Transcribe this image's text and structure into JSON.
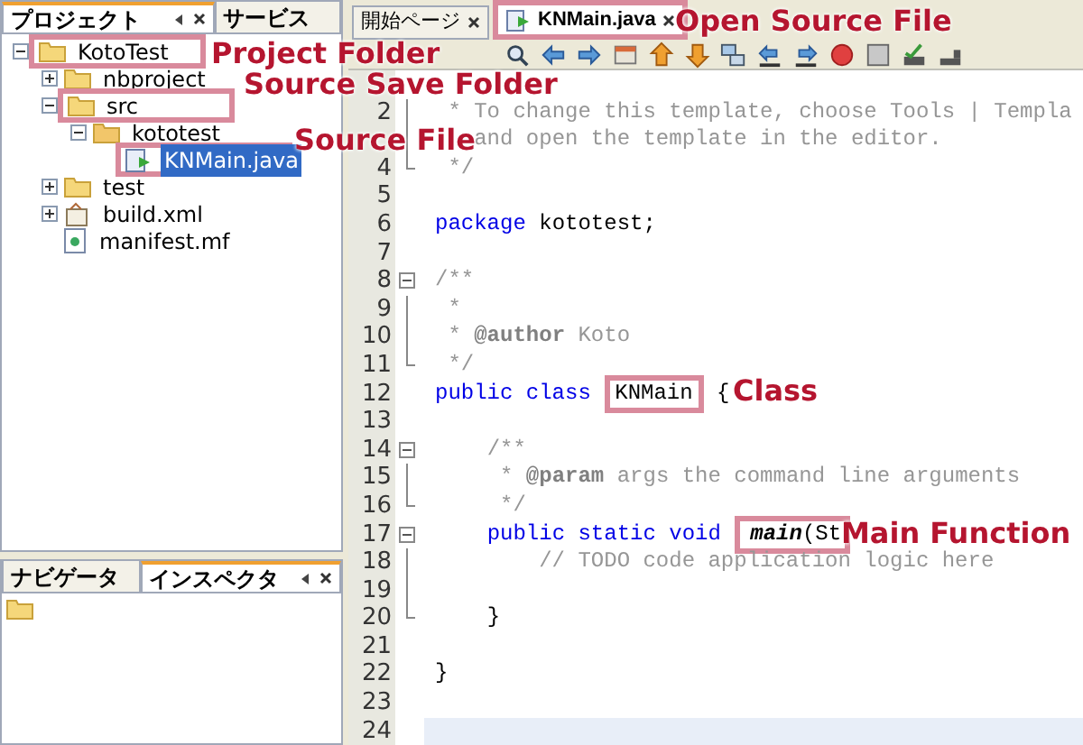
{
  "project_panel": {
    "tabs": [
      {
        "label": "プロジェクト",
        "selected": true
      },
      {
        "label": "サービス",
        "selected": false
      }
    ],
    "tree": [
      {
        "label": "KotoTest",
        "kind": "project",
        "expanded": true,
        "selected": false,
        "highlighted": true,
        "children": [
          {
            "label": "nbproject",
            "kind": "folder",
            "expanded": false,
            "selected": false,
            "highlighted": false
          },
          {
            "label": "src",
            "kind": "folder",
            "expanded": true,
            "selected": false,
            "highlighted": true,
            "children": [
              {
                "label": "kototest",
                "kind": "package",
                "expanded": true,
                "selected": false,
                "highlighted": false,
                "children": [
                  {
                    "label": "KNMain.java",
                    "kind": "java",
                    "selected": true,
                    "highlighted": true
                  }
                ]
              }
            ]
          },
          {
            "label": "test",
            "kind": "folder",
            "expanded": false,
            "selected": false,
            "highlighted": false
          },
          {
            "label": "build.xml",
            "kind": "xml",
            "expanded": false,
            "selected": false,
            "highlighted": false
          },
          {
            "label": "manifest.mf",
            "kind": "manifest",
            "selected": false,
            "highlighted": false
          }
        ]
      }
    ]
  },
  "navigator_panel": {
    "tabs": [
      {
        "label": "ナビゲータ",
        "selected": false
      },
      {
        "label": "インスペクタ",
        "selected": true
      }
    ]
  },
  "editor": {
    "tabs": [
      {
        "label": "開始ページ",
        "selected": false,
        "highlighted": false
      },
      {
        "label": "KNMain.java",
        "selected": true,
        "highlighted": true
      }
    ],
    "lines": [
      {
        "kind": "covered",
        "current": false
      },
      {
        "number": "2",
        "kind": "fold_line",
        "current": false,
        "segments": [
          {
            "text": " * To change this template, choose Tools | Templa",
            "kind": "comment"
          }
        ]
      },
      {
        "kind": "fold_line",
        "current": false,
        "segments": [
          {
            "text": "   and open the template in the editor.",
            "kind": "comment"
          }
        ]
      },
      {
        "number": "4",
        "kind": "fold_end",
        "current": false,
        "segments": [
          {
            "text": " */",
            "kind": "comment"
          }
        ]
      },
      {
        "number": "5",
        "kind": "plain",
        "current": false
      },
      {
        "number": "6",
        "kind": "plain",
        "current": false,
        "segments": [
          {
            "text": "package",
            "kind": "keyword"
          },
          {
            "text": " kototest;",
            "kind": "plain"
          }
        ]
      },
      {
        "number": "7",
        "kind": "plain",
        "current": false
      },
      {
        "number": "8",
        "kind": "fold_start",
        "current": false,
        "segments": [
          {
            "text": "/**",
            "kind": "comment"
          }
        ]
      },
      {
        "number": "9",
        "kind": "fold_line",
        "current": false,
        "segments": [
          {
            "text": " *",
            "kind": "comment"
          }
        ]
      },
      {
        "number": "10",
        "kind": "fold_line",
        "current": false,
        "segments": [
          {
            "text": " * ",
            "kind": "comment"
          },
          {
            "text": "@author",
            "kind": "tag"
          },
          {
            "text": " Koto",
            "kind": "comment"
          }
        ]
      },
      {
        "number": "11",
        "kind": "fold_end",
        "current": false,
        "segments": [
          {
            "text": " */",
            "kind": "comment"
          }
        ]
      },
      {
        "number": "12",
        "kind": "plain",
        "current": false,
        "segments": [
          {
            "text": "public class ",
            "kind": "keyword"
          },
          {
            "text": "KNMain",
            "kind": "boxed"
          },
          {
            "text": " {",
            "kind": "plain"
          }
        ]
      },
      {
        "number": "13",
        "kind": "plain",
        "current": false
      },
      {
        "number": "14",
        "kind": "fold_start",
        "current": false,
        "segments": [
          {
            "text": "    /**",
            "kind": "comment"
          }
        ]
      },
      {
        "number": "15",
        "kind": "fold_line",
        "current": false,
        "segments": [
          {
            "text": "     * ",
            "kind": "comment"
          },
          {
            "text": "@param",
            "kind": "tag"
          },
          {
            "text": " args the command line arguments",
            "kind": "comment"
          }
        ]
      },
      {
        "number": "16",
        "kind": "fold_end",
        "current": false,
        "segments": [
          {
            "text": "     */",
            "kind": "comment"
          }
        ]
      },
      {
        "number": "17",
        "kind": "fold_start",
        "current": false,
        "segments": [
          {
            "text": "    public static void ",
            "kind": "keyword"
          },
          {
            "text": "main",
            "kind": "boxed_italic"
          },
          {
            "text": "(St",
            "kind": "boxed_tail"
          }
        ]
      },
      {
        "number": "18",
        "kind": "fold_line",
        "current": false,
        "segments": [
          {
            "text": "        // TODO code application logic here",
            "kind": "comment"
          }
        ]
      },
      {
        "number": "19",
        "kind": "fold_line",
        "current": false
      },
      {
        "number": "20",
        "kind": "fold_end",
        "current": false,
        "segments": [
          {
            "text": "    }",
            "kind": "plain"
          }
        ]
      },
      {
        "number": "21",
        "kind": "plain",
        "current": false
      },
      {
        "number": "22",
        "kind": "plain",
        "current": false,
        "segments": [
          {
            "text": "}",
            "kind": "plain"
          }
        ]
      },
      {
        "number": "23",
        "kind": "plain",
        "current": false
      },
      {
        "number": "24",
        "kind": "plain",
        "current": true
      }
    ]
  },
  "annotations": [
    {
      "text": "Project Folder"
    },
    {
      "text": "Source Save Folder"
    },
    {
      "text": "Source File"
    },
    {
      "text": "Open Source File"
    },
    {
      "text": "Class"
    },
    {
      "text": "Main Function"
    }
  ]
}
